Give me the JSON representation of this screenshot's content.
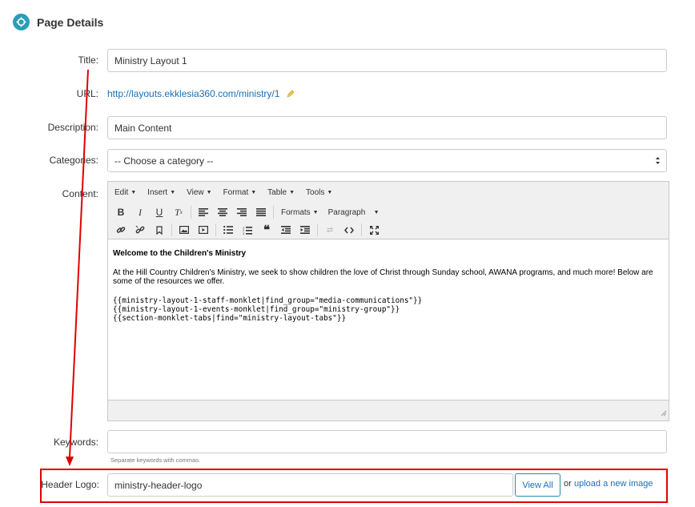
{
  "header": {
    "title": "Page Details",
    "icon": "crosshair-icon",
    "accent": "#2a9eb5"
  },
  "form": {
    "title_label": "Title:",
    "title_value": "Ministry Layout 1",
    "url_label": "URL:",
    "url_value": "http://layouts.ekklesia360.com/ministry/1",
    "description_label": "Description:",
    "description_value": "Main Content",
    "categories_label": "Categories:",
    "categories_value": "-- Choose a category --",
    "content_label": "Content:",
    "keywords_label": "Keywords:",
    "keywords_value": "",
    "keywords_help": "Separate keywords with commas.",
    "header_logo_label": "Header Logo:",
    "header_logo_value": "ministry-header-logo",
    "view_all_label": "View All",
    "or_text": "or",
    "upload_link": "upload a new image"
  },
  "editor": {
    "menus": [
      "Edit",
      "Insert",
      "View",
      "Format",
      "Table",
      "Tools"
    ],
    "formats_label": "Formats",
    "paragraph_label": "Paragraph",
    "content": {
      "heading": "Welcome to the Children's Ministry",
      "paragraph": "At the Hill Country Children's Ministry, we seek to show children the love of Christ through Sunday school, AWANA programs, and much more! Below are some of the resources we offer.",
      "code_lines": [
        "{{ministry-layout-1-staff-monklet|find_group=\"media-communications\"}}",
        "{{ministry-layout-1-events-monklet|find_group=\"ministry-group\"}}",
        "{{section-monklet-tabs|find=\"ministry-layout-tabs\"}}"
      ]
    }
  },
  "annotation": {
    "color": "#e00000"
  }
}
